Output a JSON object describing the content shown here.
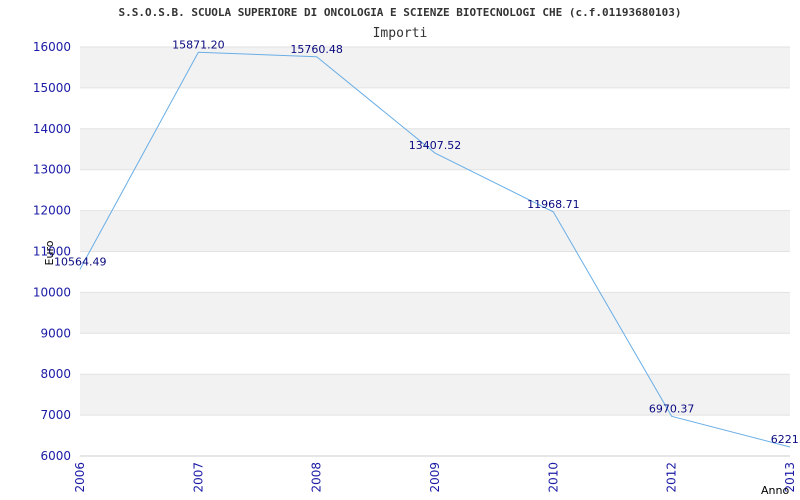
{
  "chart_data": {
    "type": "line",
    "title": "S.S.O.S.B. SCUOLA SUPERIORE DI ONCOLOGIA E SCIENZE BIOTECNOLOGI CHE (c.f.01193680103)",
    "subtitle": "Importi",
    "xlabel": "Anno",
    "ylabel": "Euro",
    "categories": [
      "2006",
      "2007",
      "2008",
      "2009",
      "2010",
      "2012",
      "2013"
    ],
    "values": [
      10564.49,
      15871.2,
      15760.48,
      13407.52,
      11968.71,
      6970.37,
      6221.0
    ],
    "data_labels": [
      "10564.49",
      "15871.20",
      "15760.48",
      "13407.52",
      "11968.71",
      "6970.37",
      "6221.0"
    ],
    "ylim": [
      6000,
      16000
    ],
    "yticks": [
      "6000",
      "7000",
      "8000",
      "9000",
      "10000",
      "11000",
      "12000",
      "13000",
      "14000",
      "15000",
      "16000"
    ],
    "grid": true,
    "colors": {
      "line": "#6aaee6",
      "band": "#f2f2f2",
      "tick_text": "#1a1aa6",
      "label_text": "#0a0a80"
    }
  }
}
